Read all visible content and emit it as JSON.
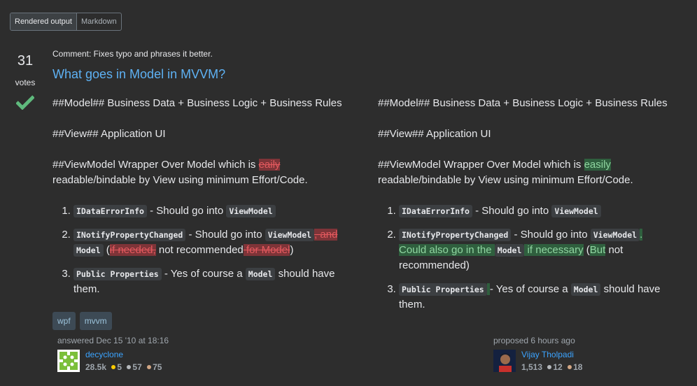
{
  "tabs": [
    {
      "label": "Rendered output",
      "active": true
    },
    {
      "label": "Markdown",
      "active": false
    }
  ],
  "votes": {
    "count": "31",
    "label": "votes",
    "accepted": true
  },
  "comment": "Comment: Fixes typo and phrases it better.",
  "title": "What goes in Model in MVVM?",
  "left": {
    "paragraphs": [
      [
        {
          "t": "text",
          "v": "##Model## Business Data + Business Logic + Business Rules"
        }
      ],
      [
        {
          "t": "text",
          "v": "##View## Application UI"
        }
      ],
      [
        {
          "t": "text",
          "v": "##ViewModel Wrapper Over Model which is "
        },
        {
          "t": "del",
          "v": "eaily"
        },
        {
          "t": "text",
          "v": " readable/bindable by View using minimum Effort/Code."
        }
      ]
    ],
    "list": [
      [
        {
          "t": "code",
          "v": "IDataErrorInfo"
        },
        {
          "t": "text",
          "v": " - Should go into "
        },
        {
          "t": "code",
          "v": "ViewModel"
        }
      ],
      [
        {
          "t": "code",
          "v": "INotifyPropertyChanged"
        },
        {
          "t": "text",
          "v": " - Should go into "
        },
        {
          "t": "code",
          "v": "ViewModel"
        },
        {
          "t": "del",
          "v": ", and"
        },
        {
          "t": "text",
          "v": " "
        },
        {
          "t": "code",
          "v": "Model"
        },
        {
          "t": "text",
          "v": " ("
        },
        {
          "t": "del",
          "v": "if needed,"
        },
        {
          "t": "text",
          "v": " not recommended"
        },
        {
          "t": "del",
          "v": " for Model"
        },
        {
          "t": "text",
          "v": ")"
        }
      ],
      [
        {
          "t": "code",
          "v": "Public Properties"
        },
        {
          "t": "text",
          "v": " - Yes of course a "
        },
        {
          "t": "code",
          "v": "Model"
        },
        {
          "t": "text",
          "v": " should have them."
        }
      ]
    ]
  },
  "right": {
    "paragraphs": [
      [
        {
          "t": "text",
          "v": "##Model## Business Data + Business Logic + Business Rules"
        }
      ],
      [
        {
          "t": "text",
          "v": "##View## Application UI"
        }
      ],
      [
        {
          "t": "text",
          "v": "##ViewModel Wrapper Over Model which is "
        },
        {
          "t": "ins",
          "v": "easily"
        },
        {
          "t": "text",
          "v": " readable/bindable by View using minimum Effort/Code."
        }
      ]
    ],
    "list": [
      [
        {
          "t": "code",
          "v": "IDataErrorInfo"
        },
        {
          "t": "text",
          "v": " - Should go into "
        },
        {
          "t": "code",
          "v": "ViewModel"
        }
      ],
      [
        {
          "t": "code",
          "v": "INotifyPropertyChanged"
        },
        {
          "t": "text",
          "v": " - Should go into "
        },
        {
          "t": "code",
          "v": "ViewModel"
        },
        {
          "t": "ins",
          "v": ". Could also go in the "
        },
        {
          "t": "code",
          "v": "Model"
        },
        {
          "t": "ins",
          "v": " if necessary"
        },
        {
          "t": "text",
          "v": " ("
        },
        {
          "t": "ins",
          "v": "But"
        },
        {
          "t": "text",
          "v": " not recommended)"
        }
      ],
      [
        {
          "t": "code",
          "v": "Public Properties"
        },
        {
          "t": "ins",
          "v": " "
        },
        {
          "t": "text",
          "v": " - Yes of course a "
        },
        {
          "t": "code",
          "v": "Model"
        },
        {
          "t": "text",
          "v": " should have them."
        }
      ]
    ]
  },
  "tags": [
    "wpf",
    "mvvm"
  ],
  "answered": {
    "action": "answered Dec 15 '10 at 18:16",
    "user": "decyclone",
    "rep": "28.5k",
    "gold": "5",
    "silver": "57",
    "bronze": "75"
  },
  "proposed": {
    "action": "proposed 6 hours ago",
    "user": "Vijay Tholpadi",
    "rep": "1,513",
    "silver": "12",
    "bronze": "18"
  },
  "colors": {
    "link": "#3ca4ff",
    "title": "#5eb1f3",
    "accepted": "#5fba7d",
    "gold": "#ffcc01",
    "silver": "#b4b8bc",
    "bronze": "#d1a684"
  }
}
